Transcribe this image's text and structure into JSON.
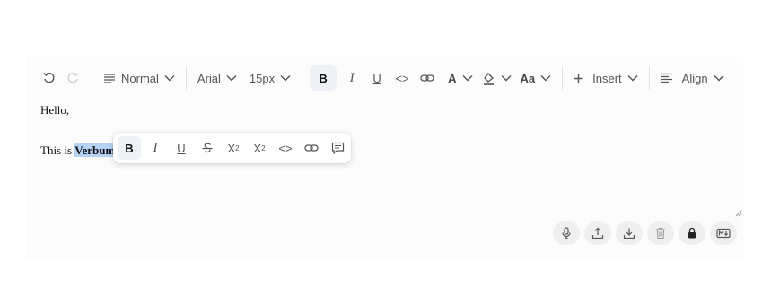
{
  "toolbar": {
    "block_type": "Normal",
    "font_family": "Arial",
    "font_size": "15px",
    "bold_label": "B",
    "italic_label": "I",
    "underline_label": "U",
    "code_label": "<>",
    "text_color_label": "A",
    "case_label": "Aa",
    "insert_label": "Insert",
    "align_label": "Align"
  },
  "content": {
    "line1": "Hello,",
    "line2_prefix": "This is ",
    "line2_selected": "Verbum",
    "line2_suffix": "."
  },
  "bubble": {
    "bold_label": "B",
    "italic_label": "I",
    "underline_label": "U",
    "subscript_label": "X",
    "subscript_mark": "2",
    "superscript_label": "X",
    "superscript_mark": "2",
    "code_label": "<>"
  },
  "actions": {
    "icons": [
      "microphone-icon",
      "upload-icon",
      "download-icon",
      "trash-icon",
      "lock-icon",
      "markdown-icon"
    ]
  },
  "colors": {
    "selection": "#b4d3f5",
    "active_button": "#eef2f7",
    "action_button": "#efefef",
    "background": "#fcfcfc"
  }
}
